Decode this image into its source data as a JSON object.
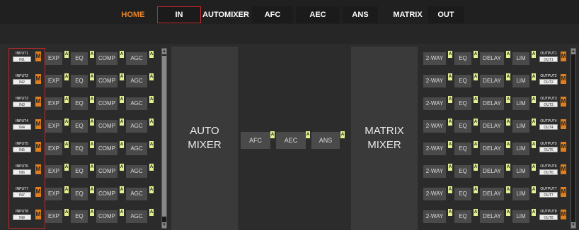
{
  "nav": {
    "tabs": [
      "HOME",
      "IN",
      "AUTOMIXER",
      "AFC",
      "AEC",
      "ANS",
      "MATRIX",
      "OUT"
    ]
  },
  "colors": {
    "accent_orange": "#e07f1e",
    "highlight_red": "#c0282a",
    "a_badge": "#e4ef8f"
  },
  "inputs": [
    {
      "top": "INPUT1",
      "name": "IN1"
    },
    {
      "top": "INPUT2",
      "name": "IN2"
    },
    {
      "top": "INPUT3",
      "name": "IN3"
    },
    {
      "top": "INPUT4",
      "name": "IN4"
    },
    {
      "top": "INPUT5",
      "name": "IN5"
    },
    {
      "top": "INPUT6",
      "name": "IN6"
    },
    {
      "top": "INPUT7",
      "name": "IN7"
    },
    {
      "top": "INPUT8",
      "name": "IN8"
    }
  ],
  "outputs": [
    {
      "top": "OUTPUT1",
      "name": "OUT1"
    },
    {
      "top": "OUTPUT2",
      "name": "OUT2"
    },
    {
      "top": "OUTPUT3",
      "name": "OUT3"
    },
    {
      "top": "OUTPUT4",
      "name": "OUT4"
    },
    {
      "top": "OUTPUT5",
      "name": "OUT5"
    },
    {
      "top": "OUTPUT6",
      "name": "OUT6"
    },
    {
      "top": "OUTPUT7",
      "name": "OUT7"
    },
    {
      "top": "OUTPUT8",
      "name": "OUT8"
    }
  ],
  "input_chain": [
    "EXP",
    "EQ",
    "COMP",
    "AGC"
  ],
  "output_chain": [
    "2-WAY",
    "EQ",
    "DELAY",
    "LIM"
  ],
  "mute_label": "M",
  "active_label": "A",
  "automixer": {
    "line1": "AUTO",
    "line2": "MIXER"
  },
  "matrix": {
    "line1": "MATRIX",
    "line2": "MIXER"
  },
  "mid_chain": [
    "AFC",
    "AEC",
    "ANS"
  ]
}
